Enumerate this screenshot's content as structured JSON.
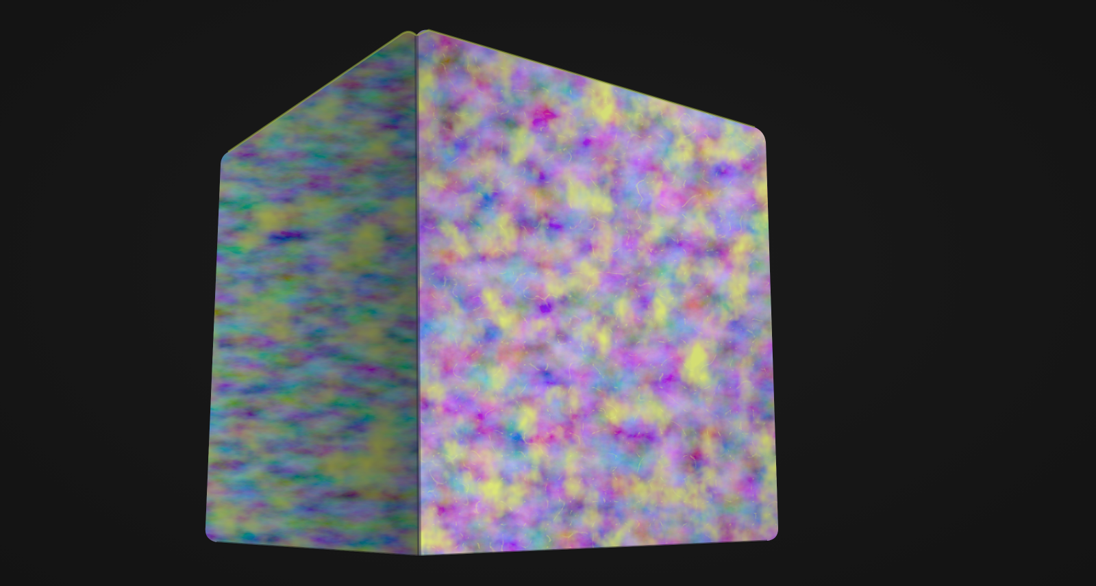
{
  "scene": {
    "background_color": "#161616",
    "subject": "textured-cube",
    "material": {
      "colors": {
        "moss": "#8f9a24",
        "moss_bright": "#c2d23a",
        "stone_purple": "#5a4a86",
        "stone_light": "#9a86b8",
        "stone_blue": "#3f5676",
        "crack_glow": "#d6ee3a"
      }
    }
  }
}
